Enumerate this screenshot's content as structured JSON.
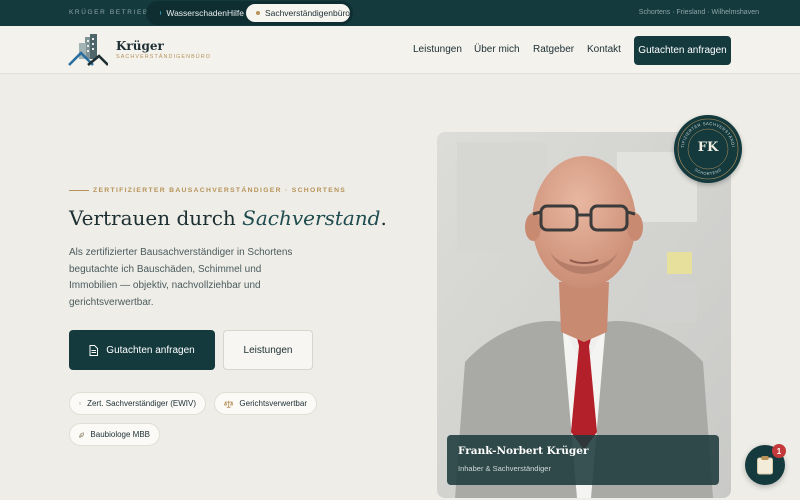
{
  "topbar": {
    "brand": "KRÜGER BETRIEBE",
    "switch": [
      {
        "label": "WasserschadenHilfe",
        "active": false
      },
      {
        "label": "Sachverständigenbüro",
        "active": true
      }
    ],
    "locations": "Schortens · Friesland · Wilhelmshaven"
  },
  "header": {
    "logo_name": "Krüger",
    "logo_sub": "SACHVERSTÄNDIGENBÜRO",
    "nav": [
      "Leistungen",
      "Über mich",
      "Ratgeber",
      "Kontakt"
    ],
    "cta": "Gutachten anfragen"
  },
  "hero": {
    "eyebrow": "ZERTIFIZIERTER BAUSACHVERSTÄNDIGER · SCHORTENS",
    "headline_start": "Vertrauen durch ",
    "headline_emphasis": "Sachverstand",
    "headline_end": ".",
    "lead": "Als zertifizierter Bausachverständiger in Schortens begutachte ich Bauschäden, Schimmel und Immobilien — objektiv, nachvollziehbar und gerichtsverwertbar.",
    "primary_button": "Gutachten anfragen",
    "secondary_button": "Leistungen",
    "badges": [
      "Zert. Sachverständiger (EWIV)",
      "Gerichtsverwertbar",
      "Baubiologe MBB"
    ]
  },
  "portrait": {
    "seal_top_text": "ZERTIFIZIERTER SACHVERSTÄNDIGER",
    "seal_bottom_text": "SCHORTENS",
    "seal_initials": "FK",
    "name": "Frank-Norbert Krüger",
    "role": "Inhaber & Sachverständiger"
  },
  "floating": {
    "icon": "clipboard-icon",
    "count": "1"
  },
  "colors": {
    "primary": "#143a3e",
    "accent_gold": "#b8935a",
    "background": "#eeede7",
    "badge_red": "#c43a3a"
  }
}
